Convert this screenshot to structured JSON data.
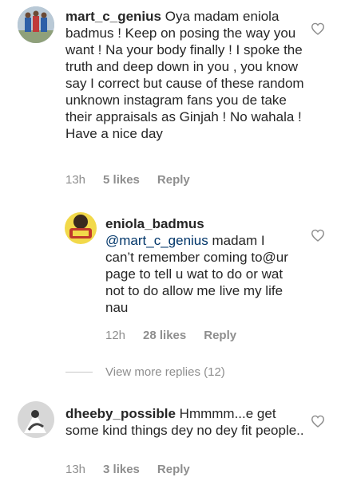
{
  "comments": [
    {
      "username": "mart_c_genius",
      "text": " Oya madam eniola badmus ! Keep on posing the way you want ! Na your body finally ! I spoke the truth and deep down in you , you know say I correct but cause of these random unknown instagram fans you de take their appraisals as Ginjah ! No wahala ! Have a nice day",
      "time": "13h",
      "likes": "5 likes",
      "reply": "Reply"
    },
    {
      "username": "eniola_badmus",
      "mention": "@mart_c_genius",
      "text": " madam I can’t remember coming to@ur page to tell u wat to do or wat not to do allow me live my life nau",
      "time": "12h",
      "likes": "28 likes",
      "reply": "Reply"
    },
    {
      "username": "dheeby_possible",
      "text": " Hmmmm...e get some kind things dey no dey fit people..",
      "time": "13h",
      "likes": "3 likes",
      "reply": "Reply"
    }
  ],
  "view_more": "View more replies (12)",
  "icons": {
    "like": "heart-outline-icon"
  },
  "colors": {
    "text": "#262626",
    "meta": "#8e8e8e",
    "mention": "#003569"
  }
}
